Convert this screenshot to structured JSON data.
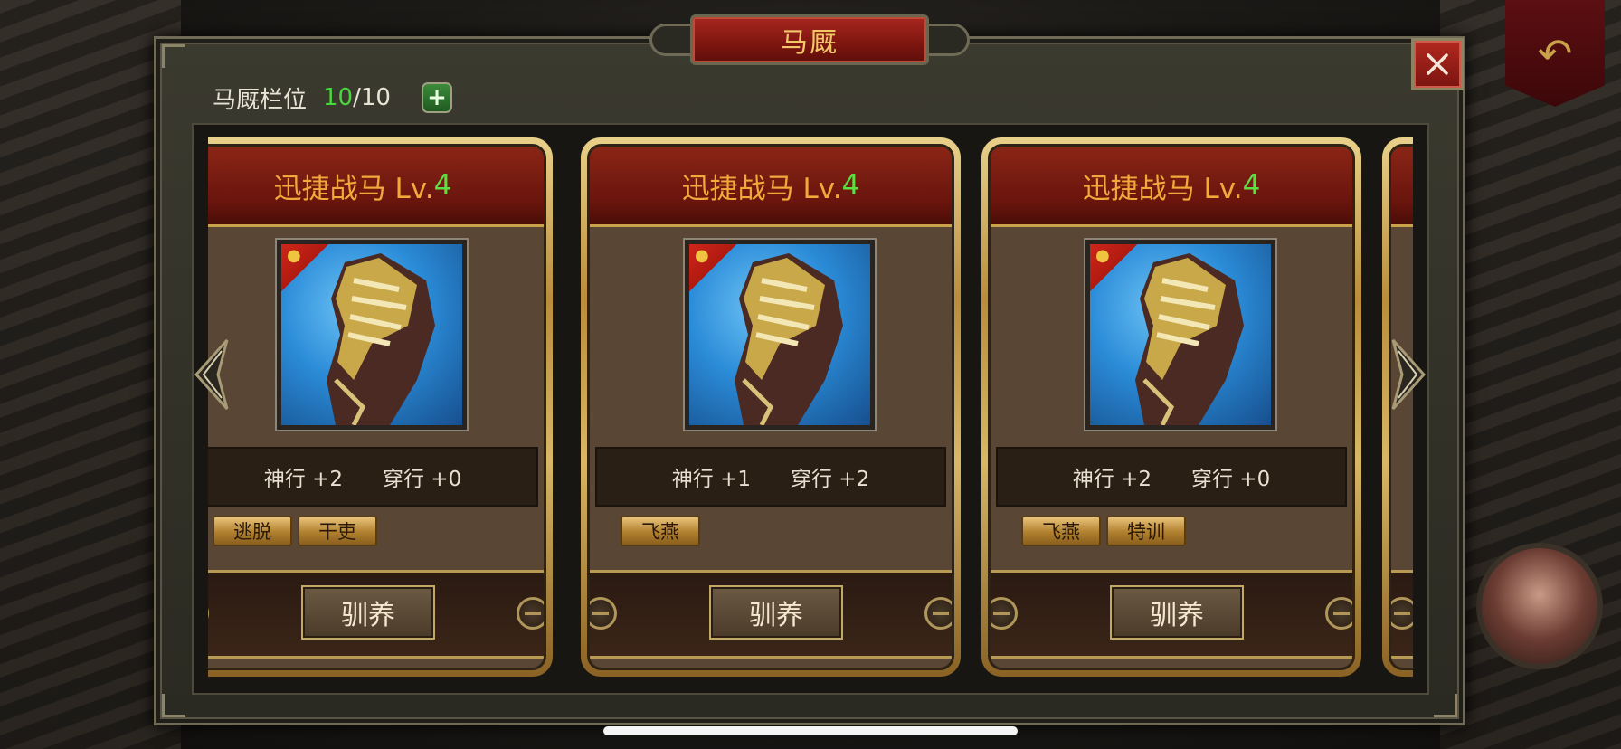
{
  "window": {
    "title": "马厩"
  },
  "header": {
    "slots_label": "马厩栏位",
    "slots_current": "10",
    "slots_max": "/10",
    "add_icon": "plus-icon"
  },
  "close_icon": "close-icon",
  "cards": [
    {
      "name": "迅捷战马 Lv.",
      "level": "4",
      "stat1": "神行 +2",
      "stat2": "穿行 +0",
      "tags": [
        "逃脱",
        "干吏"
      ],
      "action": "驯养"
    },
    {
      "name": "迅捷战马 Lv.",
      "level": "4",
      "stat1": "神行 +1",
      "stat2": "穿行 +2",
      "tags": [
        "飞燕"
      ],
      "action": "驯养"
    },
    {
      "name": "迅捷战马 Lv.",
      "level": "4",
      "stat1": "神行 +2",
      "stat2": "穿行 +0",
      "tags": [
        "飞燕",
        "特训"
      ],
      "action": "驯养"
    }
  ],
  "colors": {
    "accent_gold": "#c9a24a",
    "title_red": "#8a2516",
    "level_green": "#5be042",
    "name_orange": "#f0a93a"
  }
}
